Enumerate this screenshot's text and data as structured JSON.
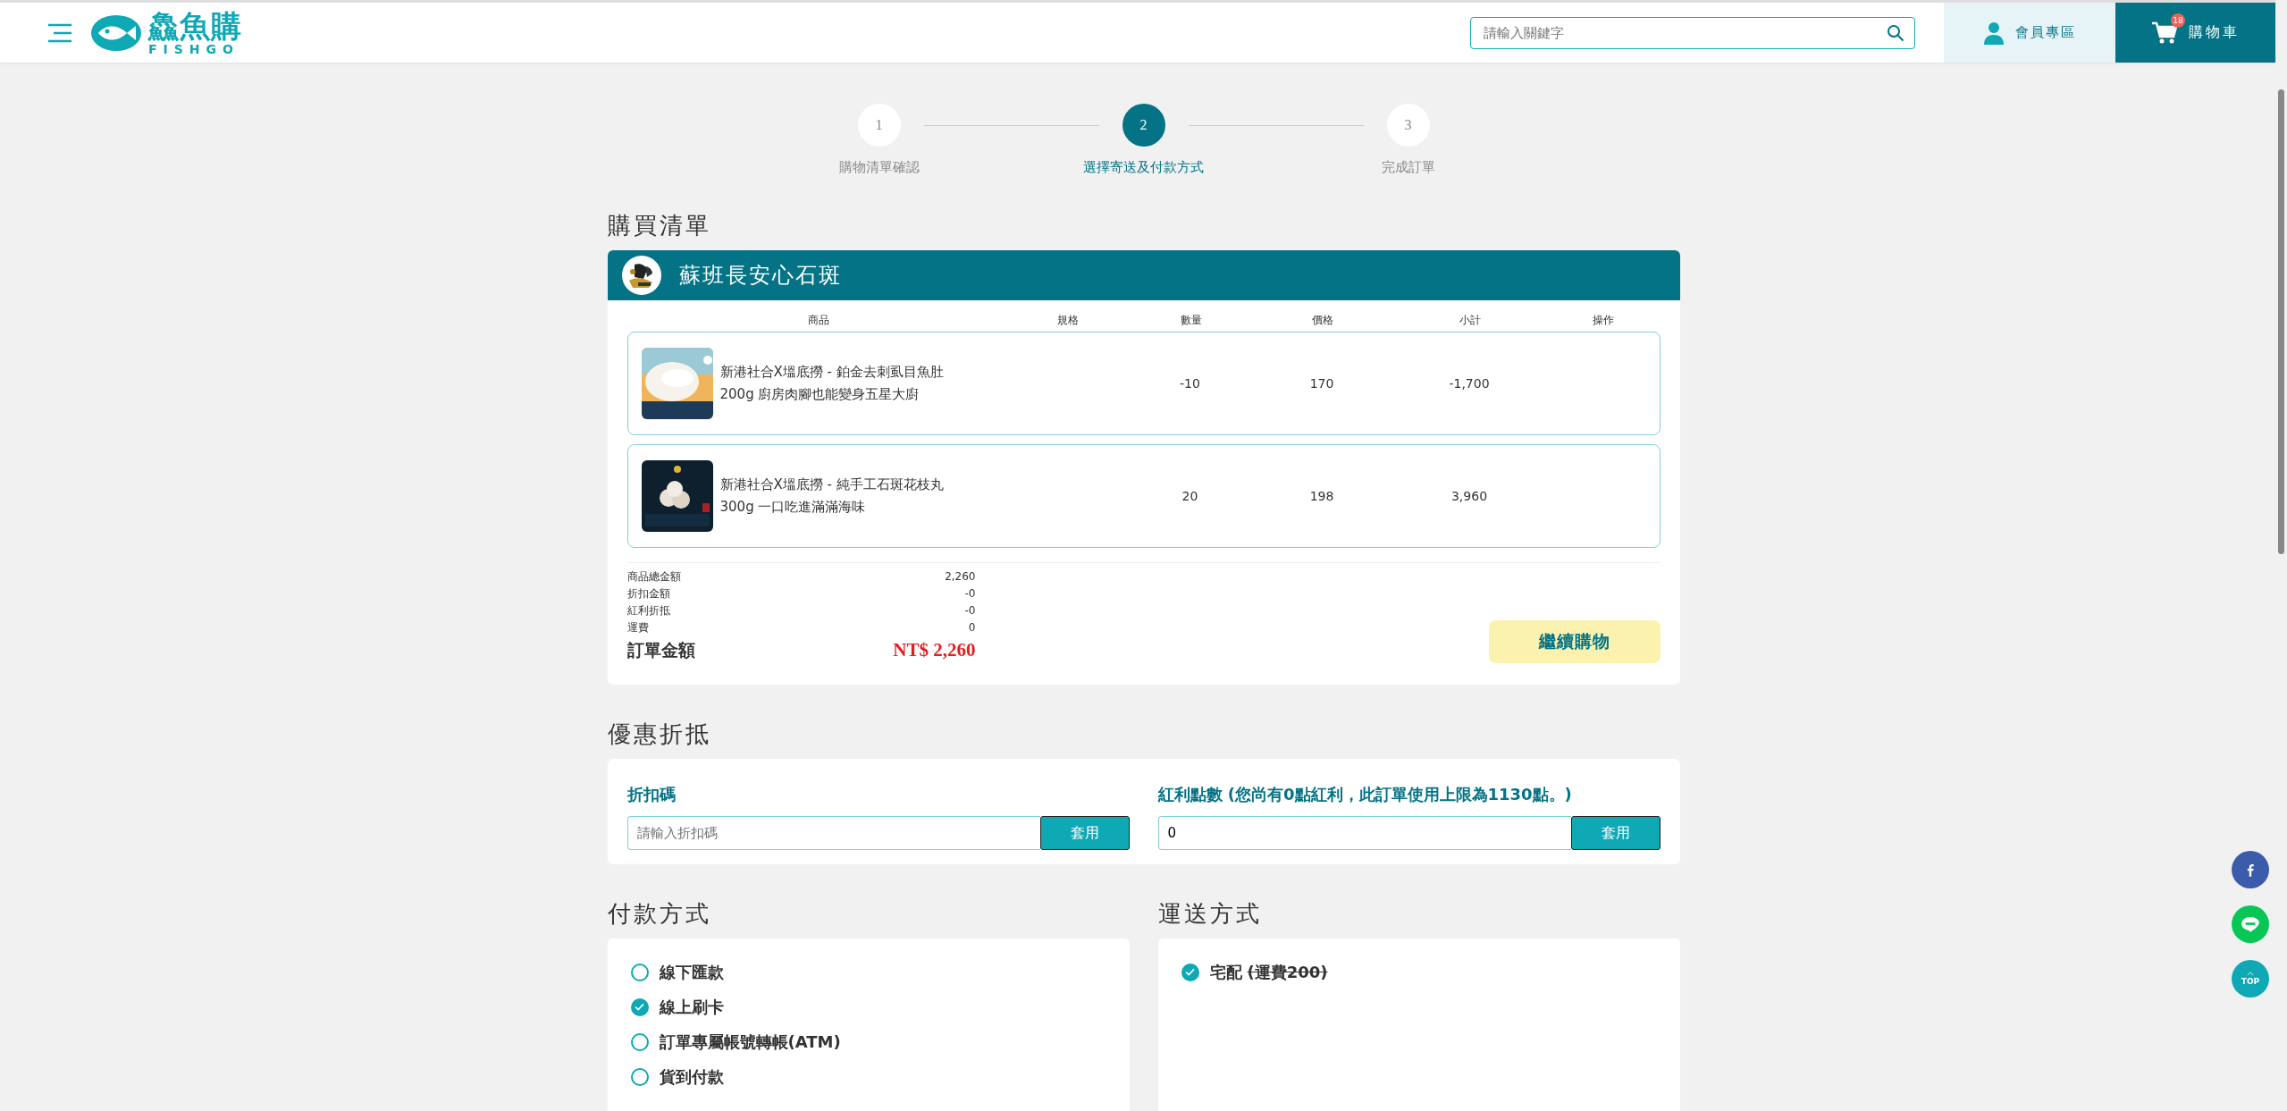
{
  "header": {
    "logo_text": "鱻魚購",
    "logo_sub": "FISHGO",
    "search": {
      "placeholder": "請輸入關鍵字"
    },
    "member": "會員專區",
    "cart": {
      "label": "購物車",
      "badge": "18"
    }
  },
  "steps": [
    {
      "number": "1",
      "label": "購物清單確認",
      "selected": false
    },
    {
      "number": "2",
      "label": "選擇寄送及付款方式",
      "selected": true
    },
    {
      "number": "3",
      "label": "完成訂單",
      "selected": false
    }
  ],
  "cart_section": {
    "title": "購買清單",
    "store": {
      "name": "蘇班長安心石斑"
    },
    "columns": [
      "商品",
      "規格",
      "數量",
      "價格",
      "小計",
      "操作"
    ],
    "rows": [
      {
        "name_lines": [
          "新港社合X塭底撈 - 鉑金去刺虱目魚肚",
          "200g 廚房肉腳也能變身五星大廚"
        ],
        "quantity": "-10",
        "price": "170",
        "subtotal": "-1,700"
      },
      {
        "name_lines": [
          "新港社合X塭底撈 - 純手工石斑花枝丸",
          "300g 一口吃進滿滿海味"
        ],
        "quantity": "20",
        "price": "198",
        "subtotal": "3,960"
      }
    ],
    "totals": [
      {
        "label": "商品總金額",
        "value": "2,260"
      },
      {
        "label": "折扣金額",
        "value": "-0"
      },
      {
        "label": "紅利折抵",
        "value": "-0"
      },
      {
        "label": "運費",
        "value": "0"
      }
    ],
    "grand_total": {
      "label": "訂單金額",
      "value": "NT$ 2,260"
    },
    "continue_button": "繼續購物"
  },
  "discount_section": {
    "title": "優惠折抵",
    "code": {
      "label": "折扣碼",
      "placeholder": "請輸入折扣碼",
      "button": "套用"
    },
    "points": {
      "label": "紅利點數 (您尚有0點紅利，此訂單使用上限為1130點。)",
      "value": "0",
      "button": "套用"
    }
  },
  "payment_section": {
    "title": "付款方式",
    "options": [
      {
        "label": "線下匯款",
        "selected": false
      },
      {
        "label": "線上刷卡",
        "selected": true
      },
      {
        "label": "訂單專屬帳號轉帳(ATM)",
        "selected": false
      },
      {
        "label": "貨到付款",
        "selected": false
      }
    ]
  },
  "shipping_section": {
    "title": "運送方式",
    "options": [
      {
        "label": "宅配",
        "fee": "(運費200)",
        "selected": true
      }
    ]
  },
  "top_button": "TOP"
}
